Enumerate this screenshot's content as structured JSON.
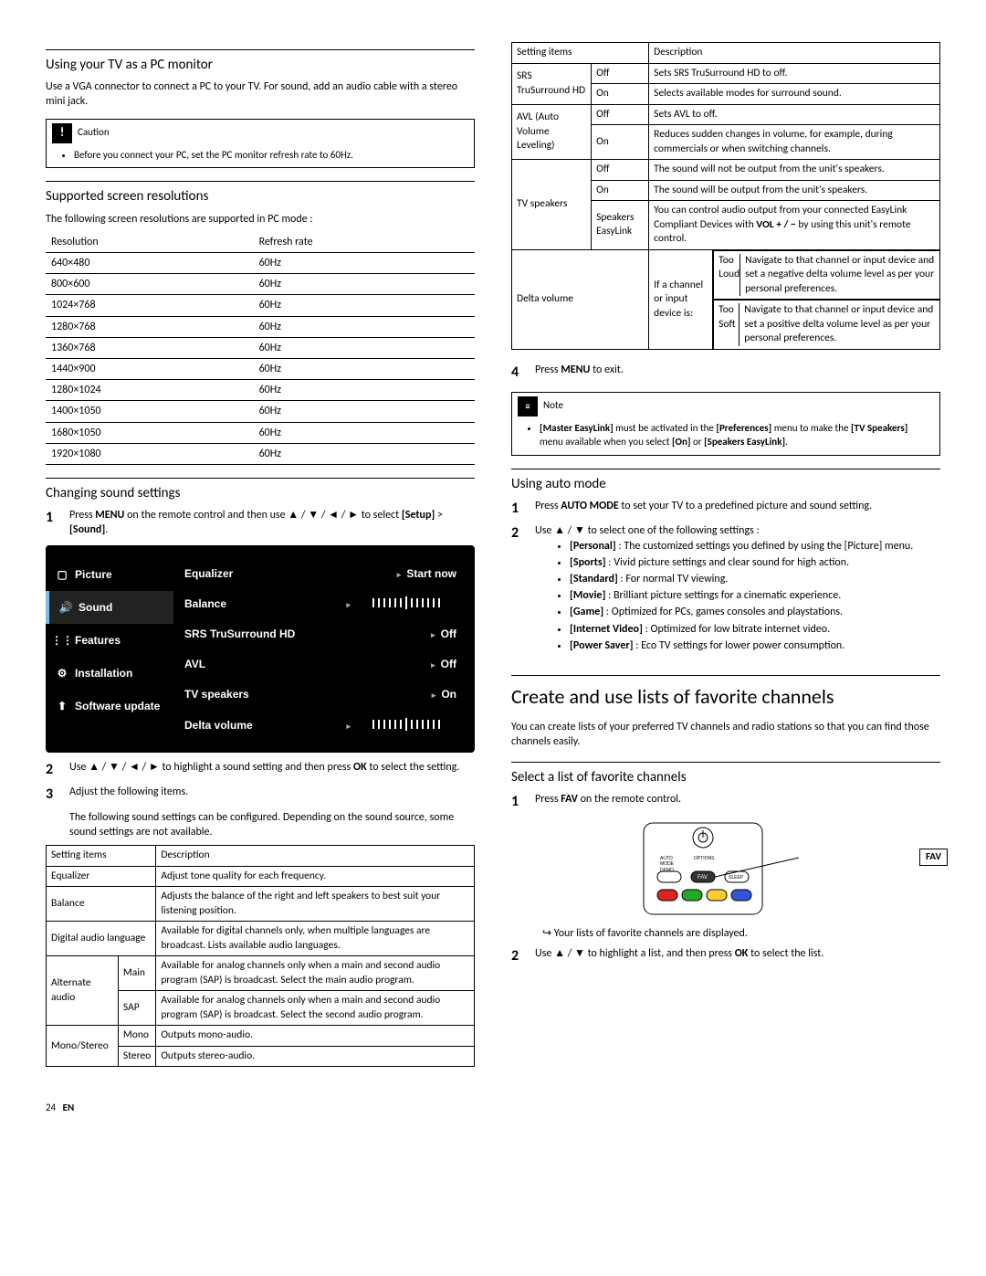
{
  "left": {
    "h_pc": "Using your TV as a PC monitor",
    "p_pc": "Use a VGA connector to connect a PC to your TV. For sound, add an audio cable with a stereo mini jack.",
    "caution_title": "Caution",
    "caution_body": "Before you connect your PC, set the PC monitor refresh rate to 60Hz.",
    "h_res": "Supported screen resolutions",
    "p_res": "The following screen resolutions are supported in PC mode :",
    "res_head": [
      "Resolution",
      "Refresh rate"
    ],
    "res_rows": [
      [
        "640×480",
        "60Hz"
      ],
      [
        "800×600",
        "60Hz"
      ],
      [
        "1024×768",
        "60Hz"
      ],
      [
        "1280×768",
        "60Hz"
      ],
      [
        "1360×768",
        "60Hz"
      ],
      [
        "1440×900",
        "60Hz"
      ],
      [
        "1280×1024",
        "60Hz"
      ],
      [
        "1400×1050",
        "60Hz"
      ],
      [
        "1680×1050",
        "60Hz"
      ],
      [
        "1920×1080",
        "60Hz"
      ]
    ],
    "h_sound": "Changing sound settings",
    "step1": "Press MENU on the remote control and then use ▲ / ▼ / ◄ / ► to select [Setup] > [Sound].",
    "osd": {
      "left": [
        "Picture",
        "Sound",
        "Features",
        "Installation",
        "Software update"
      ],
      "rows": [
        {
          "label": "Equalizer",
          "value": "Start now"
        },
        {
          "label": "Balance",
          "value": "__slider__"
        },
        {
          "label": "SRS TruSurround HD",
          "value": "Off"
        },
        {
          "label": "AVL",
          "value": "Off"
        },
        {
          "label": "TV speakers",
          "value": "On"
        },
        {
          "label": "Delta volume",
          "value": "__slider__"
        }
      ]
    },
    "step2": "Use ▲ / ▼ / ◄ / ► to highlight a sound setting and then press OK to select the setting.",
    "step3": "Adjust the following items.",
    "p_sound_cfg": "The following sound settings can be configured. Depending on the sound source, some sound settings are not available.",
    "tbl1_head": [
      "Setting items",
      "Description"
    ],
    "tbl1": {
      "equalizer": {
        "label": "Equalizer",
        "desc": "Adjust tone quality for each frequency."
      },
      "balance": {
        "label": "Balance",
        "desc": "Adjusts the balance of the right and left speakers to best suit your listening position."
      },
      "dal": {
        "label": "Digital audio language",
        "desc": "Available for digital channels only, when multiple languages are broadcast. Lists available audio languages."
      },
      "alt": {
        "label": "Alternate audio",
        "main": {
          "label": "Main",
          "desc": "Available for analog channels only when a main and second audio program (SAP) is broadcast. Select the main audio program."
        },
        "sap": {
          "label": "SAP",
          "desc": "Available for analog channels only when a main and second audio program (SAP) is broadcast. Select the second audio program."
        }
      },
      "mono": {
        "label": "Mono/Stereo",
        "mono": {
          "label": "Mono",
          "desc": "Outputs mono-audio."
        },
        "stereo": {
          "label": "Stereo",
          "desc": "Outputs stereo-audio."
        }
      }
    }
  },
  "right": {
    "tbl2_head": [
      "Setting items",
      "Description"
    ],
    "srs": {
      "label": "SRS TruSurround HD",
      "off": {
        "label": "Off",
        "desc": "Sets SRS TruSurround HD to off."
      },
      "on": {
        "label": "On",
        "desc": "Selects available modes for surround sound."
      }
    },
    "avl": {
      "label": "AVL (Auto Volume Leveling)",
      "off": {
        "label": "Off",
        "desc": "Sets AVL to off."
      },
      "on": {
        "label": "On",
        "desc": "Reduces sudden changes in volume, for example, during commercials or when switching channels."
      }
    },
    "tvspk": {
      "label": "TV speakers",
      "off": {
        "label": "Off",
        "desc": "The sound will not be output from the unit's speakers."
      },
      "on": {
        "label": "On",
        "desc": "The sound will be output from the unit's speakers."
      },
      "ez": {
        "label": "Speakers EasyLink",
        "desc": "You can control audio output from your connected EasyLink Compliant Devices with VOL + / − by using this unit's remote control."
      }
    },
    "delta": {
      "label": "Delta volume",
      "cond": "If a channel or input device is:",
      "loud": {
        "label": "Too Loud",
        "desc": "Navigate to that channel or input device and set a negative delta volume level as per your personal preferences."
      },
      "soft": {
        "label": "Too Soft",
        "desc": "Navigate to that channel or input device and set a positive delta volume level as per your personal preferences."
      }
    },
    "step4": "Press MENU to exit.",
    "note_title": "Note",
    "note_body": "[Master EasyLink] must be activated in the [Preferences] menu to make the [TV Speakers] menu available when you select [On] or [Speakers EasyLink].",
    "h_auto": "Using auto mode",
    "auto1": "Press AUTO MODE to set your TV to a predefined picture and sound setting.",
    "auto2": "Use ▲ / ▼ to select one of the following settings :",
    "auto_opts": [
      "[Personal] : The customized settings you defined by using the [Picture] menu.",
      "[Sports] : Vivid picture settings and clear sound for high action.",
      "[Standard] : For normal TV viewing.",
      "[Movie] : Brilliant picture settings for a cinematic experience.",
      "[Game] : Optimized for PCs, games consoles and playstations.",
      "[Internet Video] : Optimized for low bitrate internet video.",
      "[Power Saver] : Eco TV settings for lower power consumption."
    ],
    "h_fav_big": "Create and use lists of favorite channels",
    "p_fav": "You can create lists of your preferred TV channels and radio stations so that you can find those channels easily.",
    "h_fav": "Select a list of favorite channels",
    "fav1": "Press FAV on the remote control.",
    "fav_label": "FAV",
    "fav_result": "Your lists of favorite channels are displayed.",
    "fav2": "Use ▲ / ▼ to highlight a list, and then press OK to select the list."
  },
  "footer": {
    "page": "24",
    "lang": "EN"
  }
}
